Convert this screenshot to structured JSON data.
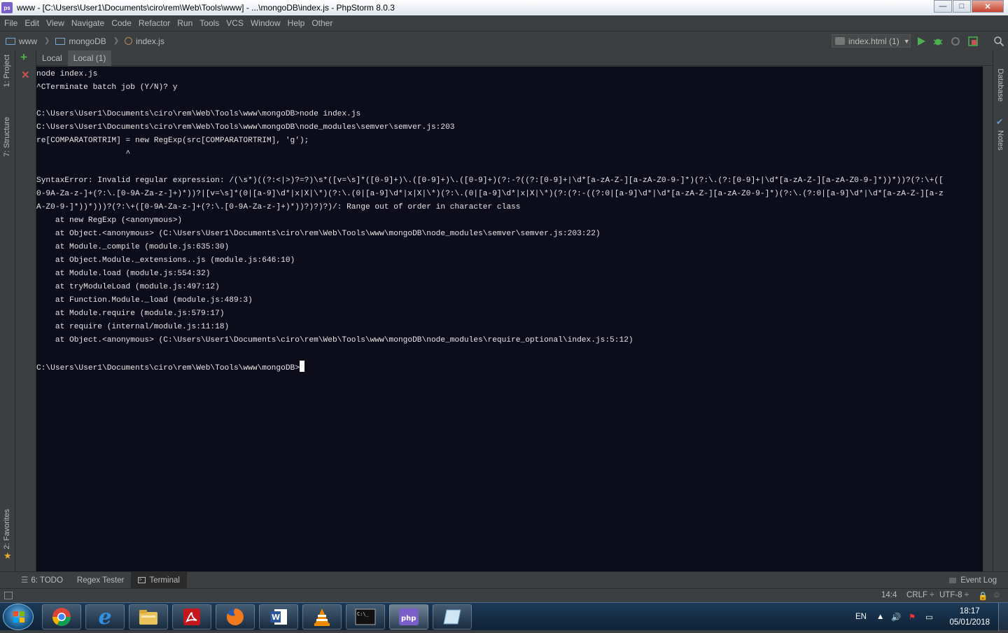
{
  "window": {
    "title": "www - [C:\\Users\\User1\\Documents\\ciro\\rem\\Web\\Tools\\www] - ...\\mongoDB\\index.js - PhpStorm 8.0.3",
    "app_icon": "ps",
    "minimize": "—",
    "maximize": "□",
    "close": "✕"
  },
  "menu": {
    "items": [
      "File",
      "Edit",
      "View",
      "Navigate",
      "Code",
      "Refactor",
      "Run",
      "Tools",
      "VCS",
      "Window",
      "Help",
      "Other"
    ]
  },
  "breadcrumb": {
    "items": [
      "www",
      "mongoDB",
      "index.js"
    ]
  },
  "run_config": {
    "label": "index.html (1)"
  },
  "left_tool_windows": {
    "project": "1: Project",
    "structure": "7: Structure",
    "favorites": "2: Favorites"
  },
  "right_tool_windows": {
    "database": "Database",
    "notes": "Notes"
  },
  "terminal": {
    "tabs": [
      "Local",
      "Local (1)"
    ],
    "active_tab": "Local (1)",
    "lines": [
      "node index.js",
      "^CTerminate batch job (Y/N)? y",
      "",
      "C:\\Users\\User1\\Documents\\ciro\\rem\\Web\\Tools\\www\\mongoDB>node index.js",
      "C:\\Users\\User1\\Documents\\ciro\\rem\\Web\\Tools\\www\\mongoDB\\node_modules\\semver\\semver.js:203",
      "re[COMPARATORTRIM] = new RegExp(src[COMPARATORTRIM], 'g');",
      "                   ^",
      "",
      "SyntaxError: Invalid regular expression: /(\\s*)((?:<|>)?=?)\\s*([v=\\s]*([0-9]+)\\.([0-9]+)\\.([0-9]+)(?:-?((?:[0-9]+|\\d*[a-zA-Z-][a-zA-Z0-9-]*)(?:\\.(?:[0-9]+|\\d*[a-zA-Z-][a-zA-Z0-9-]*))*))?(?:\\+([",
      "0-9A-Za-z-]+(?:\\.[0-9A-Za-z-]+)*))?|[v=\\s]*(0|[a-9]\\d*|x|X|\\*)(?:\\.(0|[a-9]\\d*|x|X|\\*)(?:\\.(0|[a-9]\\d*|x|X|\\*)(?:(?:-((?:0|[a-9]\\d*|\\d*[a-zA-Z-][a-zA-Z0-9-]*)(?:\\.(?:0|[a-9]\\d*|\\d*[a-zA-Z-][a-z",
      "A-Z0-9-]*))*)))?(?:\\+([0-9A-Za-z-]+(?:\\.[0-9A-Za-z-]+)*))?)?)?)/: Range out of order in character class",
      "    at new RegExp (<anonymous>)",
      "    at Object.<anonymous> (C:\\Users\\User1\\Documents\\ciro\\rem\\Web\\Tools\\www\\mongoDB\\node_modules\\semver\\semver.js:203:22)",
      "    at Module._compile (module.js:635:30)",
      "    at Object.Module._extensions..js (module.js:646:10)",
      "    at Module.load (module.js:554:32)",
      "    at tryModuleLoad (module.js:497:12)",
      "    at Function.Module._load (module.js:489:3)",
      "    at Module.require (module.js:579:17)",
      "    at require (internal/module.js:11:18)",
      "    at Object.<anonymous> (C:\\Users\\User1\\Documents\\ciro\\rem\\Web\\Tools\\www\\mongoDB\\node_modules\\require_optional\\index.js:5:12)",
      ""
    ],
    "prompt": "C:\\Users\\User1\\Documents\\ciro\\rem\\Web\\Tools\\www\\mongoDB>"
  },
  "bottom_tabs": {
    "todo": "6: TODO",
    "regex": "Regex Tester",
    "terminal": "Terminal",
    "event_log": "Event Log"
  },
  "status": {
    "position": "14:4",
    "line_sep": "CRLF ÷",
    "encoding": "UTF-8 ÷"
  },
  "taskbar": {
    "apps": [
      "chrome-icon",
      "ie-icon",
      "explorer-icon",
      "acrobat-icon",
      "firefox-icon",
      "word-icon",
      "vlc-icon",
      "cmd-icon",
      "phpstorm-icon",
      "notes-app-icon"
    ],
    "language": "EN",
    "time": "18:17",
    "date": "05/01/2018"
  },
  "colors": {
    "terminal_bg": "#0c0c1a",
    "ide_bg": "#3c3f41",
    "run_green": "#4cb14c"
  }
}
